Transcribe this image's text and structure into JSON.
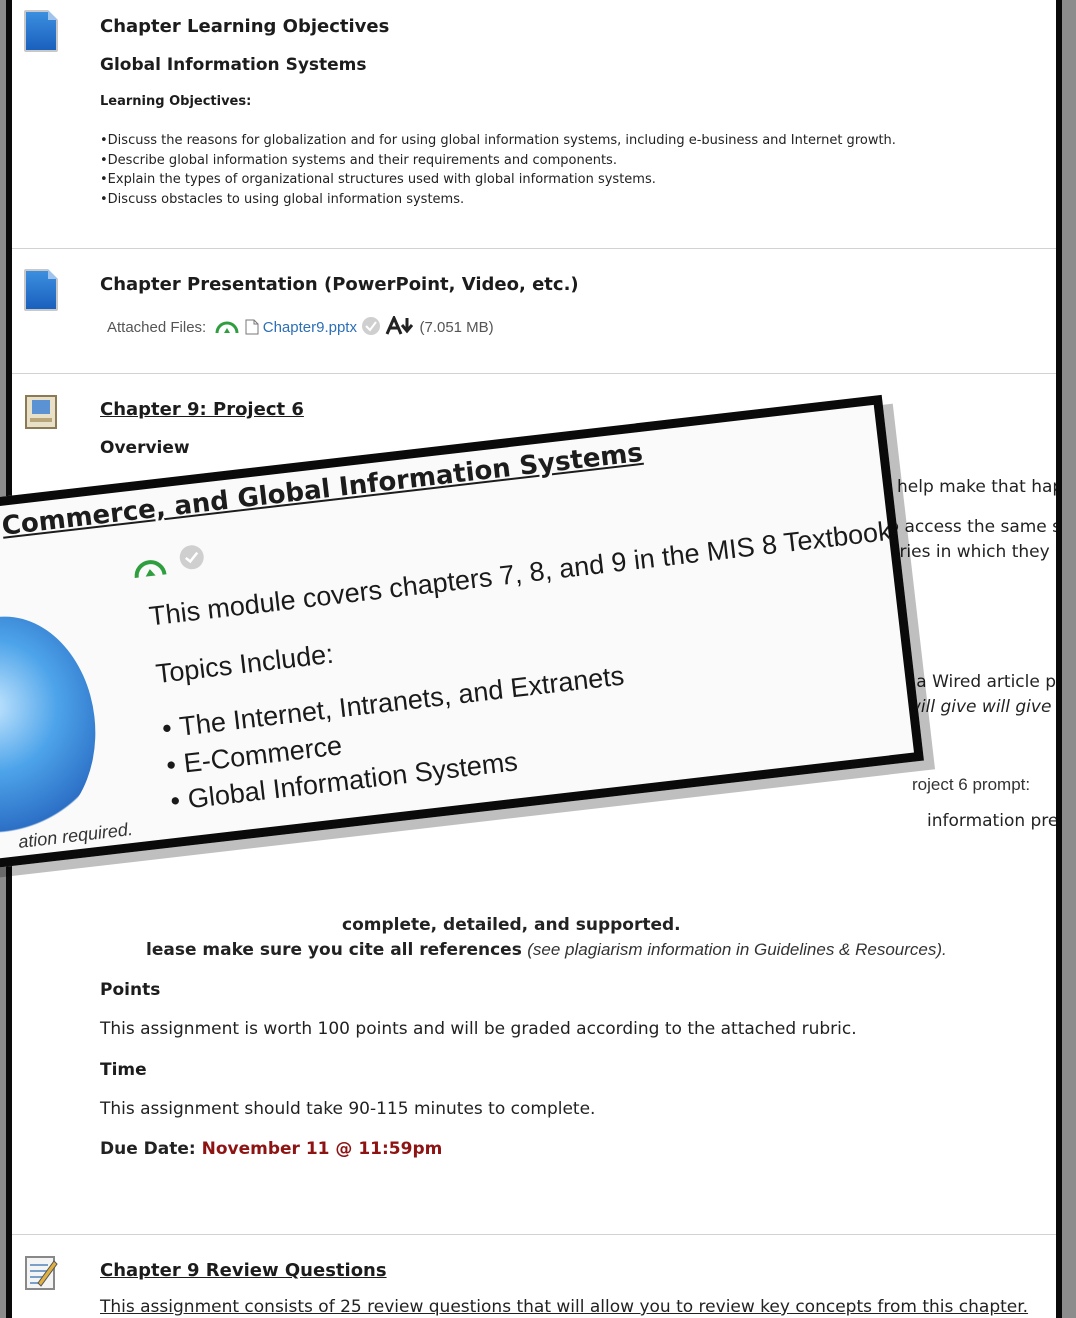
{
  "items": {
    "objectives": {
      "title": "Chapter Learning Objectives",
      "subtitle": "Global Information Systems",
      "label": "Learning Objectives:",
      "bullets": [
        "•Discuss the reasons for globalization and for using global information systems, including e-business and Internet growth.",
        "•Describe global information systems and their requirements and components.",
        "•Explain the types of organizational structures used with global information systems.",
        "•Discuss obstacles to using global information systems."
      ]
    },
    "presentation": {
      "title": "Chapter Presentation (PowerPoint, Video, etc.)",
      "attached_label": "Attached Files:",
      "file_name": "Chapter9.pptx",
      "file_size": "(7.051 MB)"
    },
    "project": {
      "title": "Chapter 9: Project 6",
      "overview": "Overview",
      "fragments": [
        "ns help make that hap",
        "to access the same s",
        "ntries in which they",
        "s a Wired article po",
        "will give will give y",
        "roject 6 prompt:",
        "information pres"
      ],
      "complete_text": "complete, detailed, and supported.",
      "cite_bold": "lease make sure you cite all references",
      "cite_italic": "(see plagiarism information in Guidelines & Resources).",
      "points_label": "Points",
      "points_text": "This assignment is worth 100 points and will be graded according to the attached rubric.",
      "time_label": "Time",
      "time_text": "This assignment should take 90-115 minutes to complete.",
      "due_label": "Due Date:",
      "due_value": "November 11 @ 11:59pm"
    },
    "review": {
      "title": "Chapter 9 Review Questions",
      "text": "This assignment consists of 25 review questions that will allow you to review key concepts from this chapter."
    }
  },
  "overlay": {
    "title": "Commerce, and Global Information Systems",
    "intro": "This module covers chapters 7, 8, and 9 in the MIS 8 Textbook.",
    "topics_label": "Topics Include:",
    "topics": [
      "The Internet, Intranets, and Extranets",
      "E-Commerce",
      "Global Information Systems"
    ],
    "footnote": "ation required."
  },
  "colors": {
    "due_date": "#8e1414",
    "link": "#2c6fb5",
    "status_green": "#2e9e3e"
  },
  "icons": [
    "document-icon",
    "project-icon",
    "review-questions-icon",
    "status-icon",
    "check-icon",
    "download-icon",
    "file-icon"
  ]
}
